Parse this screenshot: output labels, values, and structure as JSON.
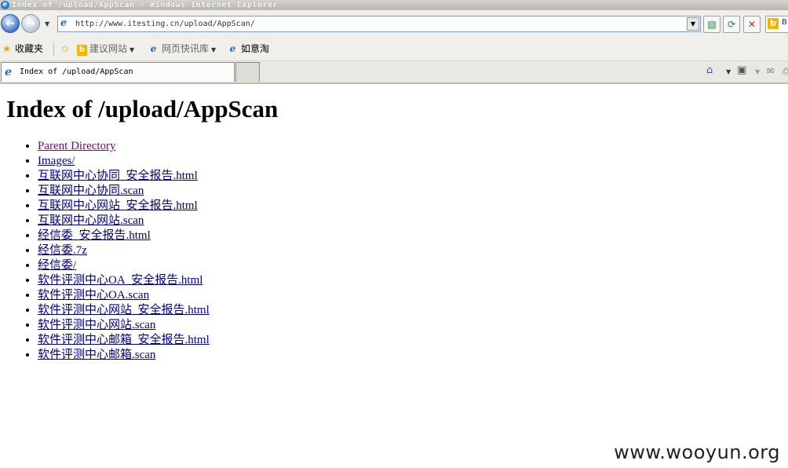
{
  "window": {
    "title": "Index of /upload/AppScan - Windows Internet Explorer"
  },
  "address_bar": {
    "url": "http://www.itesting.cn/upload/AppScan/",
    "search_partial": "B"
  },
  "favorites_bar": {
    "favorites_label": "收藏夹",
    "items": [
      {
        "label": "建议网站",
        "has_dropdown": true
      },
      {
        "label": "网页快讯库",
        "has_dropdown": true
      },
      {
        "label": "如意淘",
        "has_dropdown": false
      }
    ]
  },
  "tab": {
    "label": "Index of /upload/AppScan"
  },
  "page": {
    "heading": "Index of /upload/AppScan",
    "entries": [
      {
        "label": "Parent Directory",
        "visited": true
      },
      {
        "label": "Images/",
        "visited": false
      },
      {
        "label": "互联网中心协同_安全报告.html",
        "visited": false
      },
      {
        "label": "互联网中心协同.scan",
        "visited": false
      },
      {
        "label": "互联网中心网站_安全报告.html",
        "visited": false
      },
      {
        "label": "互联网中心网站.scan",
        "visited": false
      },
      {
        "label": "经信委_安全报告.html",
        "visited": false
      },
      {
        "label": "经信委.7z",
        "visited": false
      },
      {
        "label": "经信委/",
        "visited": false
      },
      {
        "label": "软件评测中心OA_安全报告.html",
        "visited": false
      },
      {
        "label": "软件评测中心OA.scan",
        "visited": false
      },
      {
        "label": "软件评测中心网站_安全报告.html",
        "visited": false
      },
      {
        "label": "软件评测中心网站.scan",
        "visited": false
      },
      {
        "label": "软件评测中心邮箱_安全报告.html",
        "visited": false
      },
      {
        "label": "软件评测中心邮箱.scan",
        "visited": false
      }
    ]
  },
  "watermark": "www.wooyun.org",
  "colors": {
    "link": "#00008b",
    "visited_link": "#800080",
    "chrome_bg": "#f0efec"
  },
  "icons": {
    "back": "back-arrow-icon",
    "forward": "forward-arrow-icon",
    "compat": "compatibility-view-icon",
    "refresh": "refresh-icon",
    "stop": "stop-icon",
    "home": "home-icon",
    "feeds": "rss-feed-icon"
  }
}
